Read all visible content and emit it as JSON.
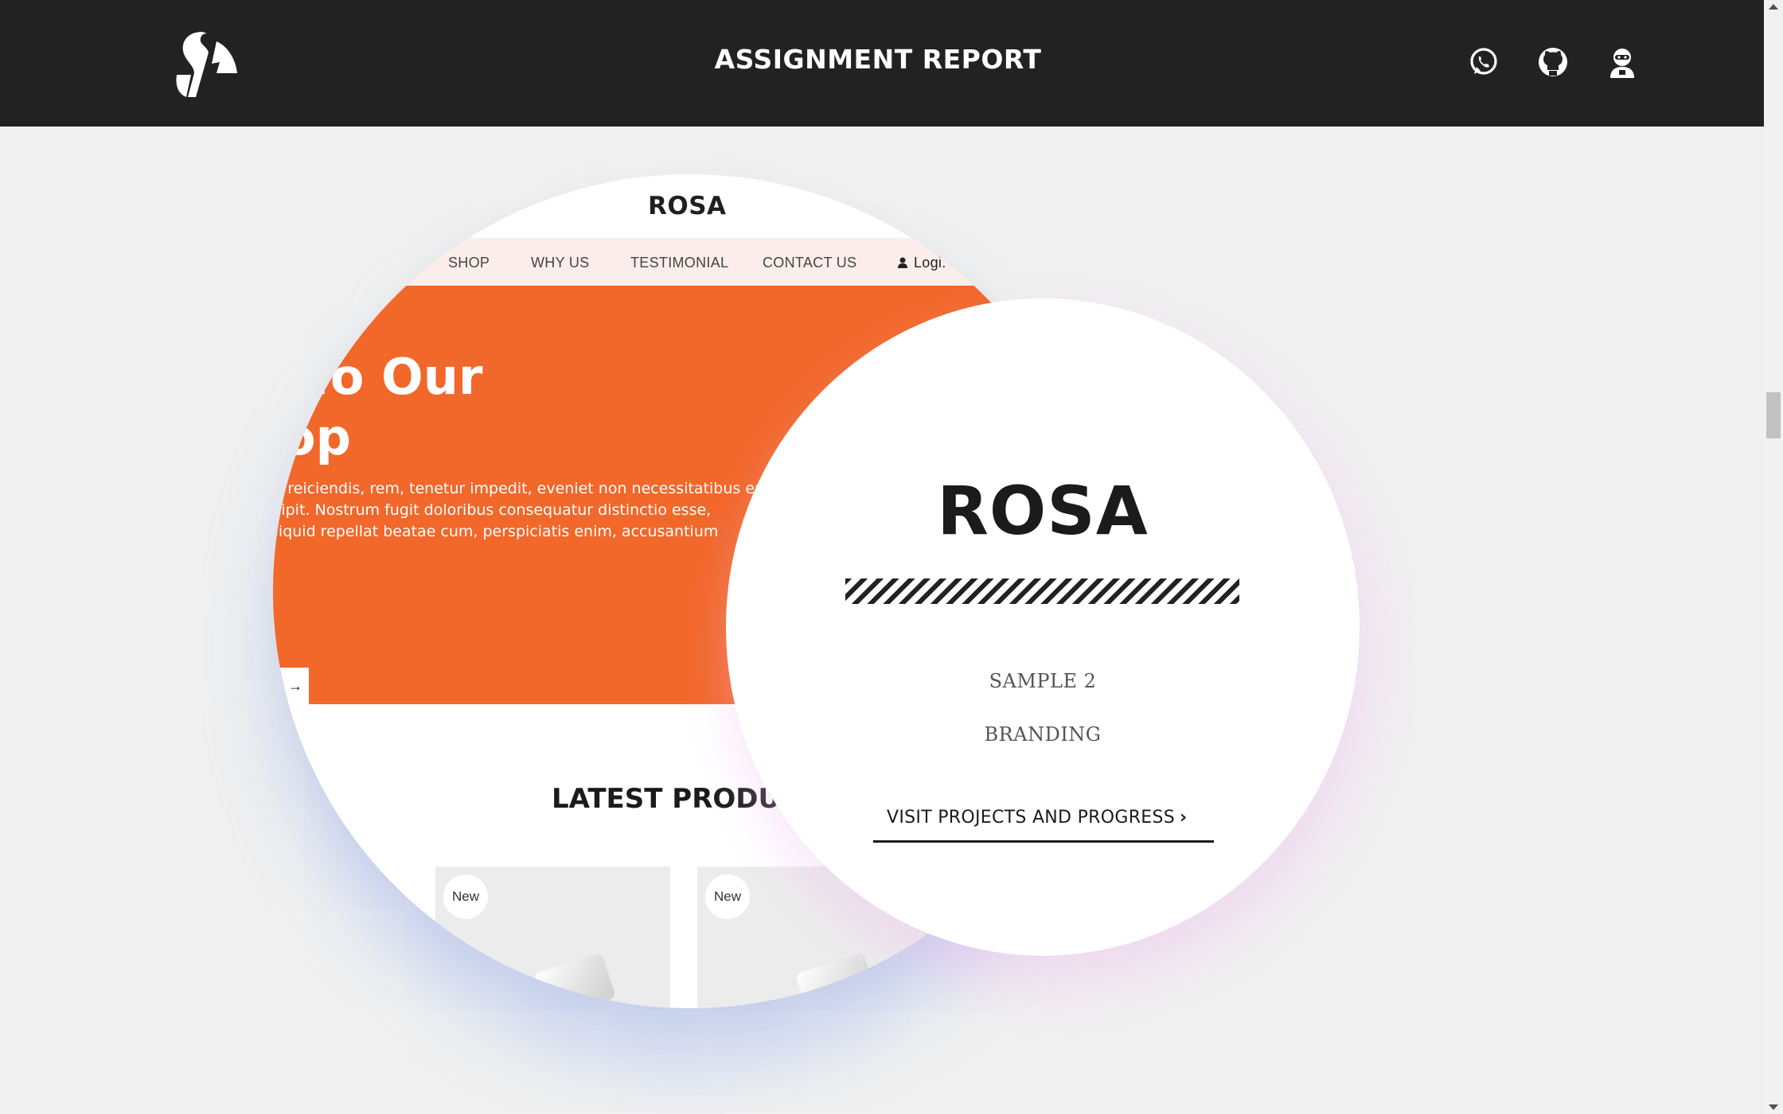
{
  "header": {
    "title": "ASSIGNMENT REPORT",
    "logo_icon": "stylized-s-logo",
    "icons": [
      "whatsapp-icon",
      "github-icon",
      "ninja-avatar-icon"
    ]
  },
  "preview": {
    "brand": "ROSA",
    "nav": [
      "SHOP",
      "WHY US",
      "TESTIMONIAL",
      "CONTACT US"
    ],
    "login": "Logi.",
    "hero_title_line1": "ne To Our",
    "hero_title_line2": "shop",
    "hero_text": [
      "lla reiciendis, rem, tenetur impedit, eveniet non necessitatibus erro",
      "scipit. Nostrum fugit doloribus consequatur distinctio esse,",
      "aliquid repellat beatae cum, perspiciatis enim, accusantium"
    ],
    "hero_button_arrow": "→",
    "latest_heading": "LATEST PRODUC",
    "badge": "New",
    "accent_color": "#f2672a"
  },
  "project": {
    "name": "ROSA",
    "sample": "SAMPLE 2",
    "category": "BRANDING",
    "link_label": "VISIT PROJECTS AND PROGRESS",
    "link_arrow": "›"
  }
}
